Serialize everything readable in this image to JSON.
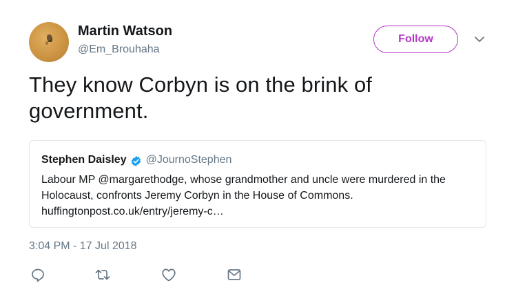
{
  "author": {
    "display_name": "Martin Watson",
    "handle": "@Em_Brouhaha"
  },
  "follow_button": {
    "label": "Follow"
  },
  "tweet": {
    "line1": "They know Corbyn is on the brink of",
    "line2": "government.",
    "timestamp": "3:04 PM - 17 Jul 2018"
  },
  "quoted_tweet": {
    "display_name": "Stephen Daisley",
    "handle": "@JournoStephen",
    "verified": true,
    "line1": "Labour MP @margarethodge, whose grandmother and uncle were murdered in the",
    "line2": "Holocaust, confronts Jeremy Corbyn in the House of Commons.",
    "line3": "huffingtonpost.co.uk/entry/jeremy-c…"
  },
  "actions": {
    "icons": [
      "reply-icon",
      "retweet-icon",
      "like-icon",
      "direct-message-icon"
    ]
  },
  "colors": {
    "accent": "#b535c8",
    "verified": "#1da1f2",
    "secondary_text": "#657786",
    "border": "#e1e8ed"
  }
}
